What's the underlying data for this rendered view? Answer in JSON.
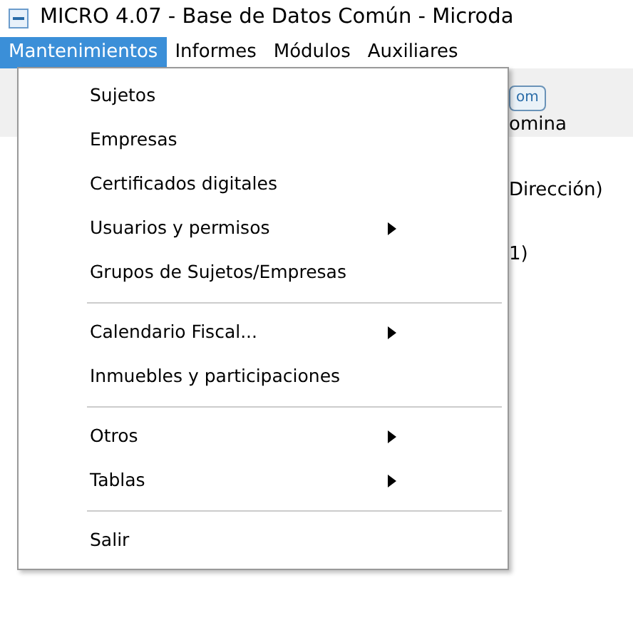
{
  "window": {
    "title": "MICRO 4.07 - Base de Datos Común - Microda"
  },
  "menu_bar": [
    {
      "label": "Mantenimientos",
      "selected": true
    },
    {
      "label": "Informes",
      "selected": false
    },
    {
      "label": "Módulos",
      "selected": false
    },
    {
      "label": "Auxiliares",
      "selected": false
    }
  ],
  "toolbar": {
    "button": "om",
    "label": "omina"
  },
  "content": [
    "Dirección)",
    "1)"
  ],
  "dropdown": [
    {
      "kind": "item",
      "label": "Sujetos",
      "submenu": false
    },
    {
      "kind": "item",
      "label": "Empresas",
      "submenu": false
    },
    {
      "kind": "item",
      "label": "Certificados digitales",
      "submenu": false
    },
    {
      "kind": "item",
      "label": "Usuarios y permisos",
      "submenu": true
    },
    {
      "kind": "item",
      "label": "Grupos de Sujetos/Empresas",
      "submenu": false
    },
    {
      "kind": "separator"
    },
    {
      "kind": "item",
      "label": "Calendario Fiscal...",
      "submenu": true
    },
    {
      "kind": "item",
      "label": "Inmuebles y participaciones",
      "submenu": false
    },
    {
      "kind": "separator"
    },
    {
      "kind": "item",
      "label": "Otros",
      "submenu": true
    },
    {
      "kind": "item",
      "label": "Tablas",
      "submenu": true
    },
    {
      "kind": "separator"
    },
    {
      "kind": "item",
      "label": "Salir",
      "submenu": false
    }
  ]
}
